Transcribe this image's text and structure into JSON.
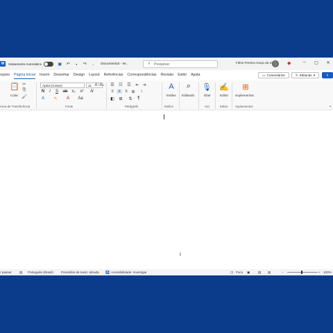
{
  "titlebar": {
    "logo_letter": "W",
    "autosave_label": "Salvamento Automático",
    "doc_title": "Documento2 - W...",
    "search_placeholder": "Pesquisar",
    "user_name": "Fábio Pereira Araujo da Silva",
    "minimize": "─",
    "restore": "▢",
    "close": "✕"
  },
  "menu": {
    "tabs": [
      "rquivo",
      "Página Inicial",
      "Inserir",
      "Desenhar",
      "Design",
      "Layout",
      "Referências",
      "Correspondências",
      "Revisão",
      "Exibir",
      "Ajuda"
    ],
    "comments_label": "Comentários",
    "editing_label": "Editando",
    "share_icon": "⇪"
  },
  "ribbon": {
    "paste_label": "Colar",
    "font_name": "Aptos (Corpo)",
    "font_size": "11",
    "styles_label": "Estilos",
    "editing_label": "Editando",
    "dictate_label": "Ditar",
    "editor_label": "Editor",
    "addins_label": "Suplementos",
    "groups": {
      "clipboard": "Área de Transferência",
      "font": "Fonte",
      "paragraph": "Parágrafo",
      "styles": "Estilos",
      "voice": "Voz",
      "editor": "Editor",
      "addins": "Suplementos"
    }
  },
  "status": {
    "page": "r passar",
    "language": "Português (Brasil)",
    "predictions": "Previsões de texto: abrada",
    "accessibility": "Acessibilidade: investigar",
    "focus": "Foco",
    "zoom": "100%"
  },
  "colors": {
    "background": "#0b3c8c",
    "accent": "#185abd"
  }
}
